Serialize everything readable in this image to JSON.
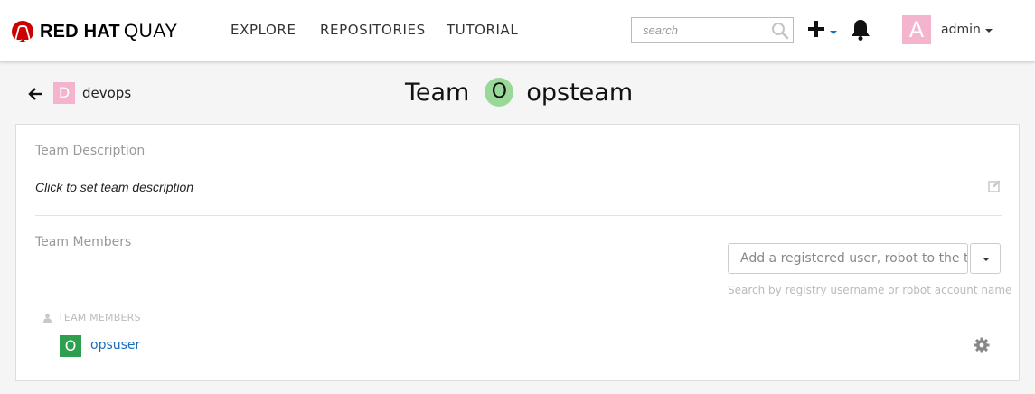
{
  "header": {
    "logo_bold": "RED HAT",
    "logo_light": "QUAY",
    "nav": [
      {
        "label": "EXPLORE"
      },
      {
        "label": "REPOSITORIES"
      },
      {
        "label": "TUTORIAL"
      }
    ],
    "search": {
      "placeholder": "search",
      "value": ""
    },
    "user": {
      "avatar_letter": "A",
      "name": "admin"
    },
    "icons": {
      "search": "search-icon",
      "create": "plus-icon",
      "notifications": "bell-icon"
    }
  },
  "breadcrumb": {
    "back_icon": "arrow-left-icon",
    "org_avatar_letter": "D",
    "org_name": "devops"
  },
  "page": {
    "title_prefix": "Team",
    "team_avatar_letter": "O",
    "team_name": "opsteam"
  },
  "description": {
    "label": "Team Description",
    "text": "Click to set team description",
    "edit_icon": "edit-icon"
  },
  "members": {
    "label": "Team Members",
    "add_placeholder": "Add a registered user, robot to the team",
    "add_hint": "Search by registry username or robot account name",
    "list_header": "TEAM MEMBERS",
    "items": [
      {
        "avatar_letter": "O",
        "name": "opsuser",
        "options_icon": "gear-icon"
      }
    ]
  },
  "colors": {
    "accent_link": "#1a6cbc",
    "logo_red": "#cc0000",
    "user_avatar": "#f5b4ce",
    "team_avatar": "#9ad89a",
    "member_avatar": "#2e9e4f"
  }
}
